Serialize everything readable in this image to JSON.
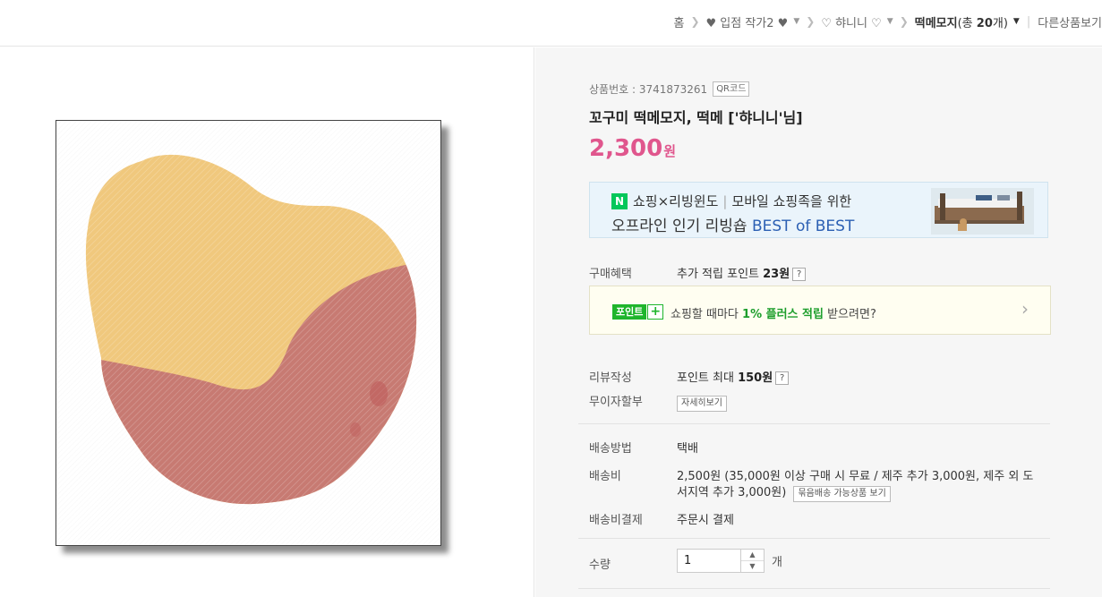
{
  "breadcrumb": {
    "home": "홈",
    "cat1": "♥ 입점 작가2 ♥",
    "cat2": "♡ 햐니니 ♡",
    "current_name": "떡메모지",
    "current_count_prefix": "(총 ",
    "current_count": "20",
    "current_count_suffix": "개)",
    "other": "다른상품보기"
  },
  "product": {
    "number_label": "상품번호 : 3741873261",
    "qr_label": "QR코드",
    "title": "꼬구미 떡메모지, 떡메 ['햐니니'님]",
    "price": "2,300",
    "price_unit": "원"
  },
  "banner": {
    "logo": "N",
    "line1_a": "쇼핑×리빙윈도",
    "line1_b": "모바일 쇼핑족을 위한",
    "line2_a": "오프라인 인기 리빙숍 ",
    "line2_best": "BEST of BEST"
  },
  "benefit": {
    "label": "구매혜택",
    "value_prefix": "추가 적립 포인트 ",
    "value_bold": "23원",
    "help": "?"
  },
  "pointbox": {
    "tag": "포인트",
    "plus": "+",
    "msg_prefix": "쇼핑할 때마다 ",
    "msg_bold": "1% 플러스 적립",
    "msg_suffix": " 받으려면?",
    "arrow": "›"
  },
  "review": {
    "label": "리뷰작성",
    "value_prefix": "포인트 최대 ",
    "value_bold": "150원",
    "help": "?"
  },
  "installment": {
    "label": "무이자할부",
    "button": "자세히보기"
  },
  "shipping": {
    "method_label": "배송방법",
    "method_value": "택배",
    "fee_label": "배송비",
    "fee_line1": "2,500원 (35,000원 이상 구매 시 무료 / 제주 추가 3,000원, 제주 외 도",
    "fee_line2": "서지역 추가 3,000원)",
    "bundle_button": "묶음배송 가능상품 보기",
    "pay_label": "배송비결제",
    "pay_value": "주문시 결제"
  },
  "quantity": {
    "label": "수량",
    "value": "1",
    "unit": "개",
    "up": "▲",
    "down": "▼"
  },
  "colors": {
    "price": "#e0568d",
    "heart_top": "#f0c87d",
    "heart_bottom": "#c77a72",
    "naver_green": "#03c75a",
    "point_green": "#1fb52c"
  }
}
